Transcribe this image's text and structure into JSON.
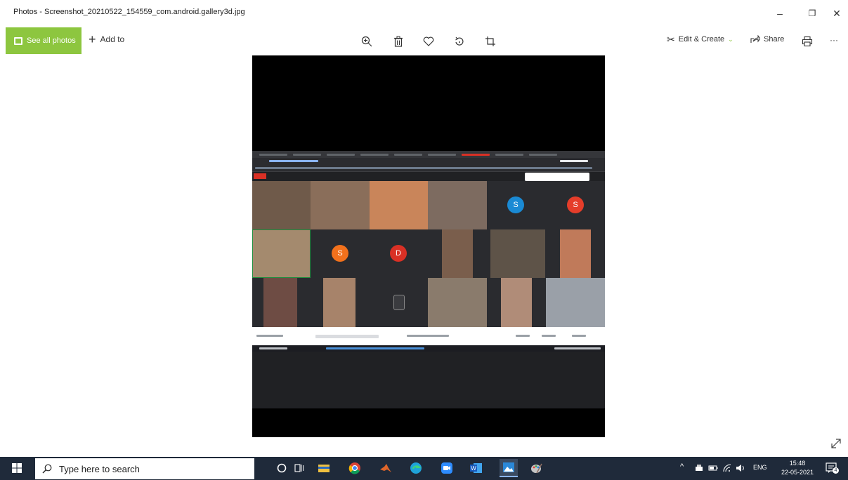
{
  "window": {
    "title": "Photos - Screenshot_20210522_154559_com.android.gallery3d.jpg",
    "minimize": "–",
    "maximize": "❐",
    "close": "✕"
  },
  "toolbar": {
    "see_all_label": "See all photos",
    "add_to_label": "Add to",
    "add_to_symbol": "+",
    "edit_create_label": "Edit & Create",
    "share_label": "Share",
    "more_label": "···"
  },
  "meeting": {
    "tiles": [
      {
        "type": "video",
        "bg": "#6f5a4a"
      },
      {
        "type": "video",
        "bg": "#8a6e5a"
      },
      {
        "type": "video",
        "bg": "#c9855a"
      },
      {
        "type": "video",
        "bg": "#7d6b60"
      },
      {
        "type": "avatar",
        "letter": "S",
        "color": "#1a8ad4"
      },
      {
        "type": "avatar",
        "letter": "S",
        "color": "#e53d2a"
      },
      {
        "type": "video",
        "bg": "#a48a6e"
      },
      {
        "type": "avatar",
        "letter": "S",
        "color": "#f2711c"
      },
      {
        "type": "avatar",
        "letter": "D",
        "color": "#d93025"
      },
      {
        "type": "video",
        "bg": "#7a5e4c"
      },
      {
        "type": "video",
        "bg": "#5e5348"
      },
      {
        "type": "video",
        "bg": "#c07a5a"
      },
      {
        "type": "video",
        "bg": "#6e4c44"
      },
      {
        "type": "video",
        "bg": "#a7836a"
      },
      {
        "type": "video",
        "bg": "#3a3b3f"
      },
      {
        "type": "video",
        "bg": "#8a7b6c"
      },
      {
        "type": "video",
        "bg": "#b08c78"
      },
      {
        "type": "video",
        "bg": "#9aa0a8"
      }
    ]
  },
  "taskbar": {
    "search_placeholder": "Type here to search",
    "language": "ENG",
    "time": "15:48",
    "date": "22-05-2021",
    "notification_count": "4"
  },
  "colors": {
    "accent_green": "#8dc63f",
    "taskbar_bg": "#1f2a3a"
  }
}
